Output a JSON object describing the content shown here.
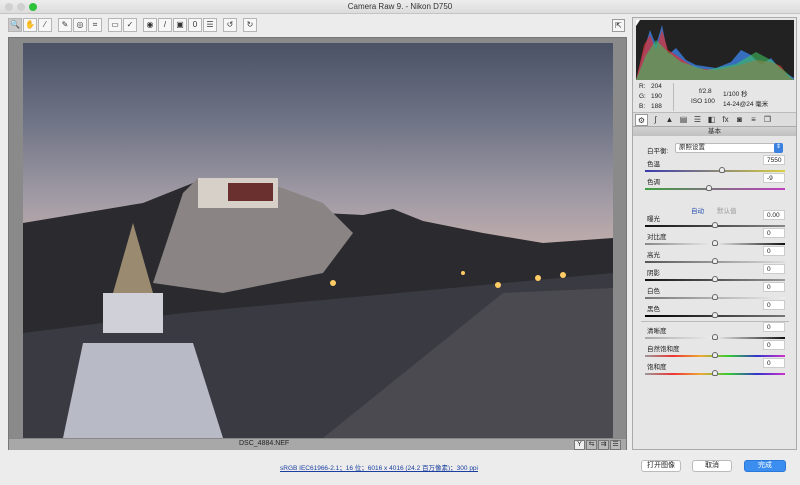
{
  "window": {
    "title": "Camera Raw 9.  -  Nikon D750"
  },
  "toolbar": {
    "tools": [
      {
        "icon": "zoom-icon",
        "g": "🔍"
      },
      {
        "icon": "hand-icon",
        "g": "✋"
      },
      {
        "icon": "white-balance-icon",
        "g": "⁄"
      },
      {
        "icon": "color-sampler-icon",
        "g": "✎"
      },
      {
        "icon": "target-adjust-icon",
        "g": "◎"
      },
      {
        "icon": "crop-icon",
        "g": "⌗"
      },
      {
        "icon": "straighten-icon",
        "g": "▭"
      },
      {
        "icon": "spot-removal-icon",
        "g": "✓"
      },
      {
        "icon": "red-eye-icon",
        "g": "◉"
      },
      {
        "icon": "adjustment-brush-icon",
        "g": "/"
      },
      {
        "icon": "graduated-filter-icon",
        "g": "▣"
      },
      {
        "icon": "radial-filter-icon",
        "g": "0"
      },
      {
        "icon": "preferences-icon",
        "g": "☰"
      },
      {
        "icon": "rotate-ccw-icon",
        "g": "↺"
      },
      {
        "icon": "rotate-cw-icon",
        "g": "↻"
      }
    ]
  },
  "viewer": {
    "filename": "DSC_4884.NEF"
  },
  "info": {
    "r_label": "R:",
    "r": "204",
    "g_label": "G:",
    "g": "190",
    "b_label": "B:",
    "b": "188",
    "aperture": "f/2.8",
    "shutter": "1/100 秒",
    "iso": "ISO 100",
    "lens": "14-24@24 毫米"
  },
  "panel": {
    "section": "基本",
    "wb_label": "白平衡:",
    "wb_value": "原照设置",
    "auto": "自动",
    "default": "默认值",
    "sliders": [
      {
        "label": "色温",
        "value": "7550",
        "pos": 0.55,
        "track": "linear-gradient(90deg,#3a3ab0,#d8d040)"
      },
      {
        "label": "色调",
        "value": "-9",
        "pos": 0.46,
        "track": "linear-gradient(90deg,#3fa040,#c040c0)"
      },
      {
        "label": "曝光",
        "value": "0.00",
        "pos": 0.5,
        "track": "linear-gradient(90deg,#111,#888)"
      },
      {
        "label": "对比度",
        "value": "0",
        "pos": 0.5,
        "track": "linear-gradient(90deg,#888,#eee,#111)"
      },
      {
        "label": "高光",
        "value": "0",
        "pos": 0.5,
        "track": "linear-gradient(90deg,#555,#ddd)"
      },
      {
        "label": "阴影",
        "value": "0",
        "pos": 0.5,
        "track": "linear-gradient(90deg,#111,#999)"
      },
      {
        "label": "白色",
        "value": "0",
        "pos": 0.5,
        "track": "linear-gradient(90deg,#777,#eee)"
      },
      {
        "label": "黑色",
        "value": "0",
        "pos": 0.5,
        "track": "linear-gradient(90deg,#000,#777)"
      },
      {
        "label": "清晰度",
        "value": "0",
        "pos": 0.5,
        "track": "linear-gradient(90deg,#aaa,#eee,#111)"
      },
      {
        "label": "自然饱和度",
        "value": "0",
        "pos": 0.5,
        "track": "linear-gradient(90deg,#999,#e33,#ea3,#3c3,#33c,#c3c)"
      },
      {
        "label": "饱和度",
        "value": "0",
        "pos": 0.5,
        "track": "linear-gradient(90deg,#999,#e33,#ea3,#3c3,#33c,#c3c)"
      }
    ]
  },
  "bottom": {
    "workflow": "sRGB IEC61966-2.1；16 位；6016 x 4016 (24.2 百万像素)；300 ppi",
    "open": "打开图像",
    "cancel": "取消",
    "done": "完成"
  }
}
